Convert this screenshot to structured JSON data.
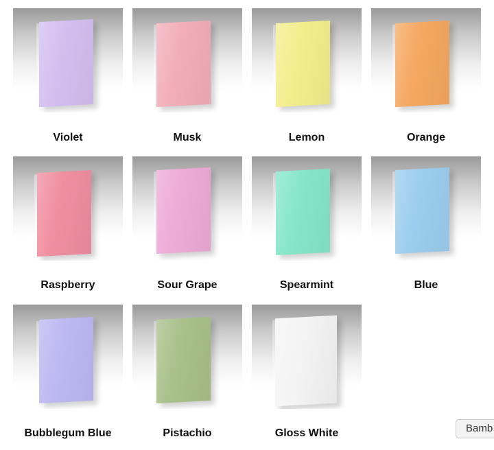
{
  "swatches": [
    {
      "name": "Violet",
      "color": "#d4bef0"
    },
    {
      "name": "Musk",
      "color": "#f2aeb8"
    },
    {
      "name": "Lemon",
      "color": "#f3ee8c"
    },
    {
      "name": "Orange",
      "color": "#f5a860"
    },
    {
      "name": "Raspberry",
      "color": "#f08ea0"
    },
    {
      "name": "Sour Grape",
      "color": "#eeaad8"
    },
    {
      "name": "Spearmint",
      "color": "#86e6c8"
    },
    {
      "name": "Blue",
      "color": "#9ccdee"
    },
    {
      "name": "Bubblegum Blue",
      "color": "#bcb8f2"
    },
    {
      "name": "Pistachio",
      "color": "#a8c08a"
    },
    {
      "name": "Gloss White",
      "color": "#f4f4f4"
    }
  ],
  "corner_button": {
    "label": "Bamb"
  }
}
